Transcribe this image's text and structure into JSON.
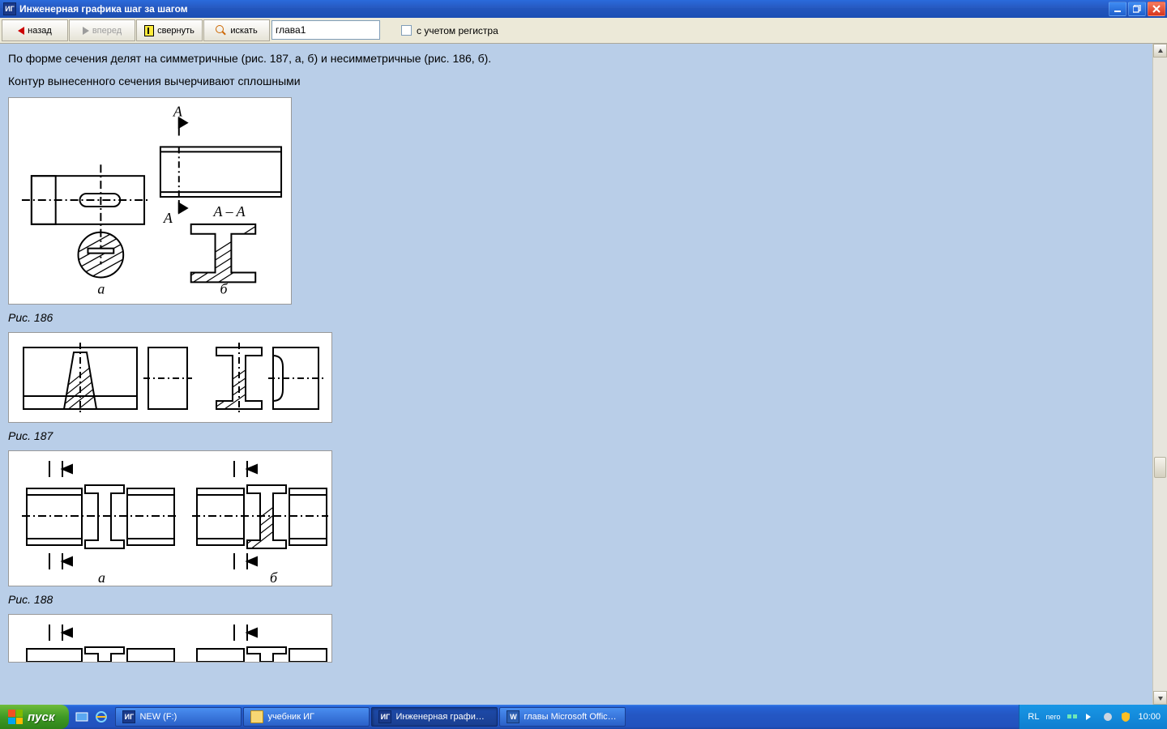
{
  "window": {
    "app_icon_text": "ИГ",
    "title": "Инженерная графика шаг за шагом"
  },
  "toolbar": {
    "back_label": "назад",
    "forward_label": "вперед",
    "collapse_label": "свернуть",
    "search_label": "искать",
    "search_value": "глава1",
    "case_label": "с учетом регистра"
  },
  "content": {
    "para1": "По форме сечения делят на симметричные (рис. 187, а, б) и несимметричные (рис. 186, б).",
    "para2": "Контур вынесенного сечения вычерчивают сплошными",
    "fig186_caption": "Рис. 186",
    "fig187_caption": "Рис. 187",
    "fig188_caption": "Рис. 188",
    "fig_labels": {
      "a": "а",
      "b": "б",
      "A": "A",
      "AA": "A – A"
    }
  },
  "taskbar": {
    "start_label": "пуск",
    "items": [
      {
        "label": "NEW (F:)",
        "icon": "app"
      },
      {
        "label": "учебник ИГ",
        "icon": "folder"
      },
      {
        "label": "Инженерная графи…",
        "icon": "app",
        "active": true
      },
      {
        "label": "главы Microsoft Offic…",
        "icon": "word"
      }
    ],
    "tray": {
      "lang": "RL",
      "brand": "nero",
      "clock": "10:00"
    }
  }
}
